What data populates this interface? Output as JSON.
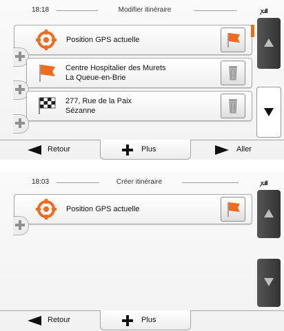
{
  "screens": [
    {
      "status": {
        "time": "18:18",
        "title": "Modifier itinéraire"
      },
      "rows": [
        {
          "line1": "Position GPS actuelle",
          "line2": "",
          "left_icon": "gps-target-icon",
          "right_icon": "flag-icon"
        },
        {
          "line1": "Centre Hospitalier des Murets",
          "line2": "La Queue-en-Brie",
          "left_icon": "flag-icon",
          "right_icon": "trash-icon"
        },
        {
          "line1": "277, Rue de la Paix",
          "line2": "Sézanne",
          "left_icon": "checkered-flag-icon",
          "right_icon": "trash-icon"
        }
      ],
      "bottom": {
        "back_label": "Retour",
        "plus_label": "Plus",
        "go_label": "Aller"
      }
    },
    {
      "status": {
        "time": "18:03",
        "title": "Créer itinéraire"
      },
      "rows": [
        {
          "line1": "Position GPS actuelle",
          "line2": "",
          "left_icon": "gps-target-icon",
          "right_icon": "flag-icon"
        }
      ],
      "bottom": {
        "back_label": "Retour",
        "plus_label": "Plus"
      }
    }
  ],
  "colors": {
    "accent": "#f26a1b",
    "scroll_dark": "#3d3d3d",
    "text": "#111111"
  }
}
